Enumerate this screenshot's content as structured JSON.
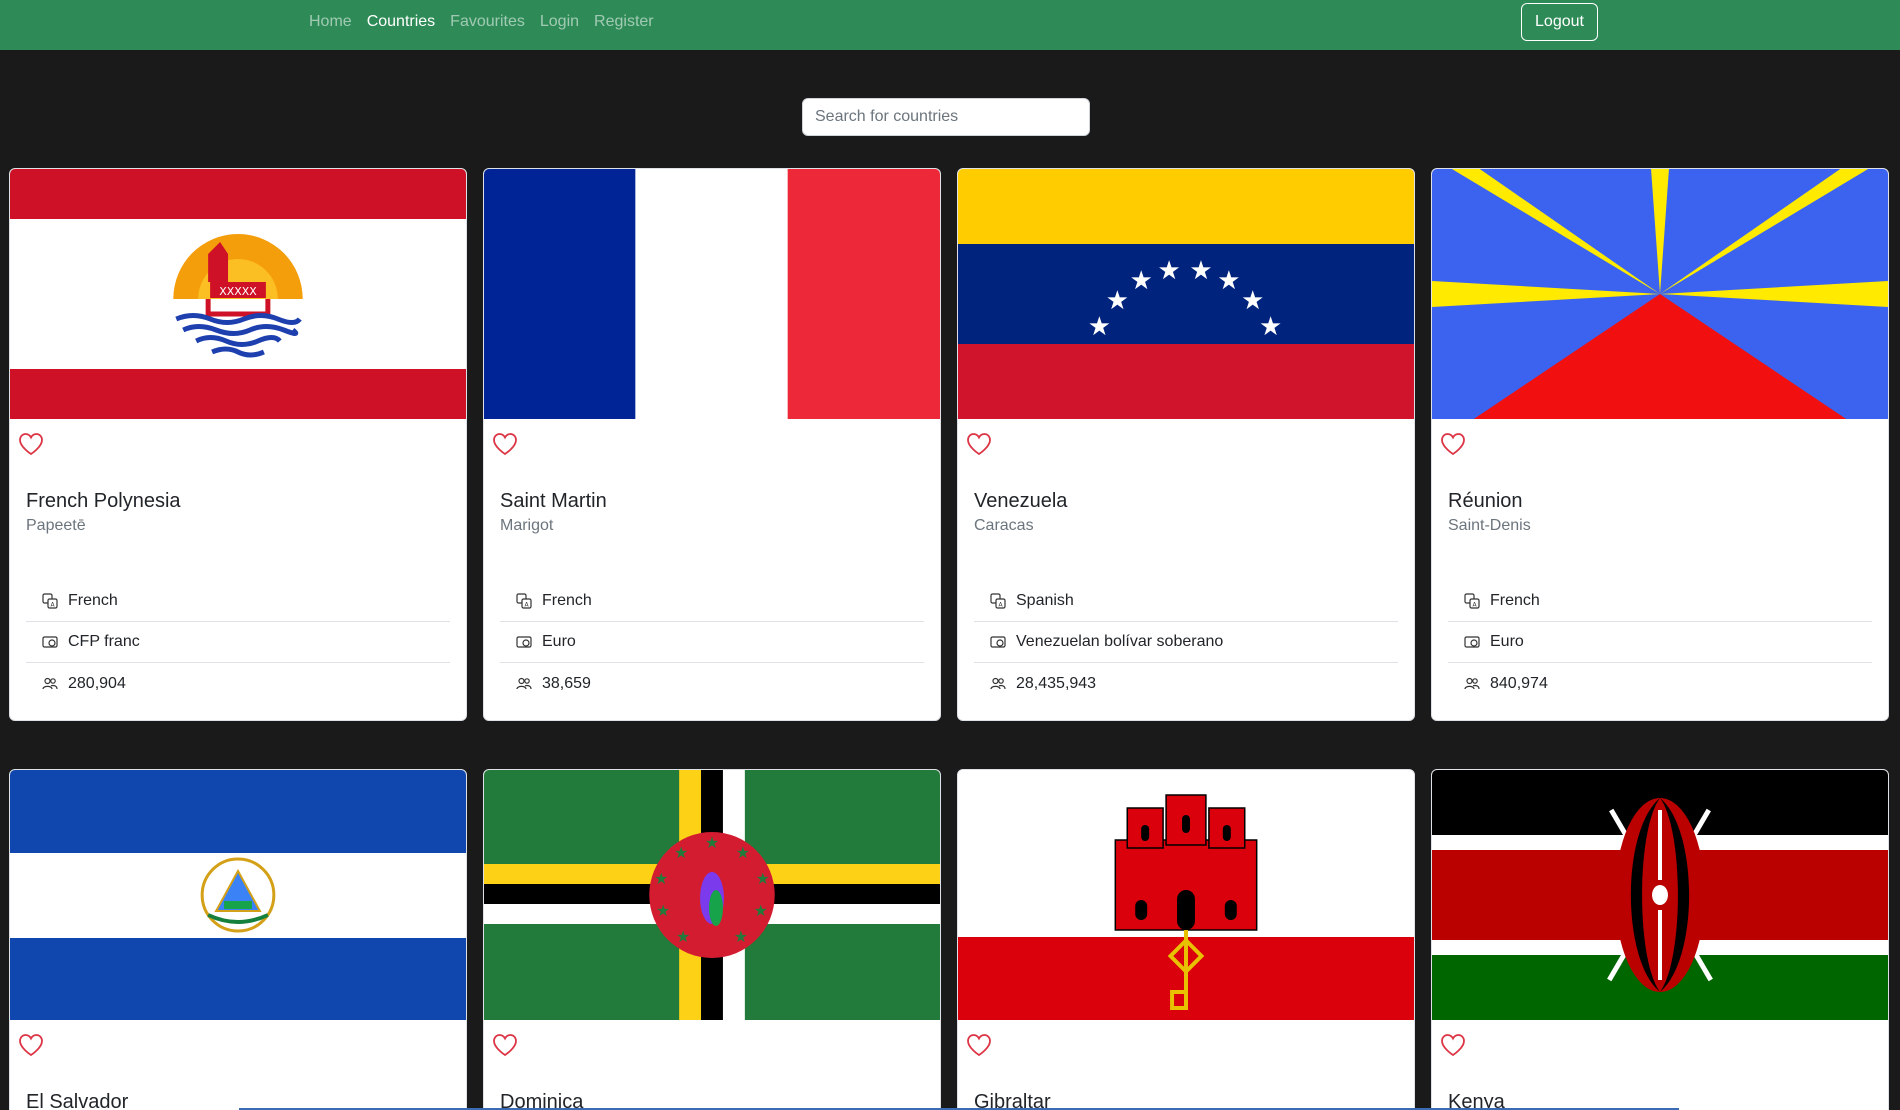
{
  "nav": {
    "links": [
      {
        "label": "Home",
        "active": false
      },
      {
        "label": "Countries",
        "active": true
      },
      {
        "label": "Favourites",
        "active": false
      },
      {
        "label": "Login",
        "active": false
      },
      {
        "label": "Register",
        "active": false
      }
    ],
    "logout_label": "Logout"
  },
  "search": {
    "placeholder": "Search for countries",
    "value": ""
  },
  "colors": {
    "navbar": "#2e8b57",
    "background": "#1a1a1a",
    "heart": "#dc3545"
  },
  "countries": [
    {
      "name": "French Polynesia",
      "capital": "Papeetē",
      "language": "French",
      "currency": "CFP franc",
      "population": "280,904",
      "flag": "french-polynesia-flag"
    },
    {
      "name": "Saint Martin",
      "capital": "Marigot",
      "language": "French",
      "currency": "Euro",
      "population": "38,659",
      "flag": "saint-martin-flag"
    },
    {
      "name": "Venezuela",
      "capital": "Caracas",
      "language": "Spanish",
      "currency": "Venezuelan bolívar soberano",
      "population": "28,435,943",
      "flag": "venezuela-flag"
    },
    {
      "name": "Réunion",
      "capital": "Saint-Denis",
      "language": "French",
      "currency": "Euro",
      "population": "840,974",
      "flag": "reunion-flag"
    },
    {
      "name": "El Salvador",
      "flag": "el-salvador-flag"
    },
    {
      "name": "Dominica",
      "flag": "dominica-flag"
    },
    {
      "name": "Gibraltar",
      "flag": "gibraltar-flag"
    },
    {
      "name": "Kenya",
      "flag": "kenya-flag"
    }
  ]
}
